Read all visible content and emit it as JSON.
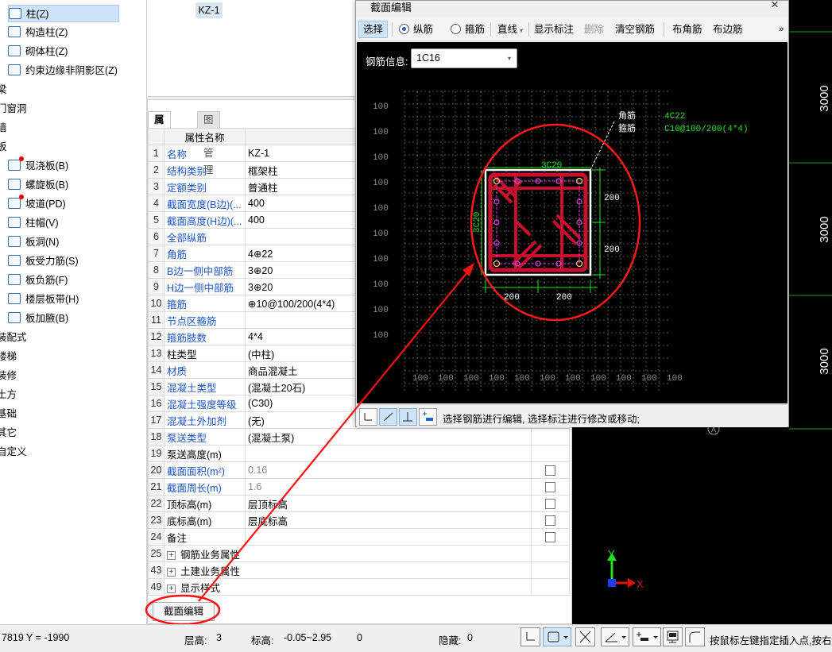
{
  "tree": {
    "items": [
      {
        "label": "柱(Z)",
        "icon": "column-icon",
        "selected": true
      },
      {
        "label": "构造柱(Z)",
        "icon": "construction-column-icon"
      },
      {
        "label": "砌体柱(Z)",
        "icon": "masonry-column-icon"
      },
      {
        "label": "约束边缘非阴影区(Z)",
        "icon": "constraint-edge-icon"
      },
      {
        "label": "梁",
        "icon": ""
      },
      {
        "label": "门窗洞",
        "icon": ""
      },
      {
        "label": "墙",
        "icon": ""
      },
      {
        "label": "板",
        "icon": ""
      },
      {
        "label": "现浇板(B)",
        "icon": "cast-slab-icon",
        "dot": true
      },
      {
        "label": "螺旋板(B)",
        "icon": "spiral-slab-icon"
      },
      {
        "label": "坡道(PD)",
        "icon": "ramp-icon",
        "dot": true
      },
      {
        "label": "柱帽(V)",
        "icon": "column-cap-icon"
      },
      {
        "label": "板洞(N)",
        "icon": "slab-hole-icon"
      },
      {
        "label": "板受力筋(S)",
        "icon": "slab-stress-rebar-icon"
      },
      {
        "label": "板负筋(F)",
        "icon": "slab-negative-rebar-icon"
      },
      {
        "label": "楼层板带(H)",
        "icon": "floor-strip-icon"
      },
      {
        "label": "板加腋(B)",
        "icon": "slab-haunch-icon"
      },
      {
        "label": "装配式",
        "icon": ""
      },
      {
        "label": "楼梯",
        "icon": ""
      },
      {
        "label": "装修",
        "icon": ""
      },
      {
        "label": "土方",
        "icon": ""
      },
      {
        "label": "基础",
        "icon": ""
      },
      {
        "label": "其它",
        "icon": ""
      },
      {
        "label": "自定义",
        "icon": ""
      }
    ]
  },
  "preview": {
    "chip": "KZ-1"
  },
  "props": {
    "tabs": [
      "属性列表",
      "图层管理"
    ],
    "header": "属性名称",
    "rows": [
      {
        "num": "1",
        "name": "名称",
        "value": "KZ-1",
        "blue": true
      },
      {
        "num": "2",
        "name": "结构类别",
        "value": "框架柱",
        "blue": true
      },
      {
        "num": "3",
        "name": "定额类别",
        "value": "普通柱",
        "blue": true
      },
      {
        "num": "4",
        "name": "截面宽度(B边)(...",
        "value": "400",
        "blue": true
      },
      {
        "num": "5",
        "name": "截面高度(H边)(...",
        "value": "400",
        "blue": true
      },
      {
        "num": "6",
        "name": "全部纵筋",
        "value": "",
        "blue": true
      },
      {
        "num": "7",
        "name": "角筋",
        "value": "4⊕22",
        "blue": true
      },
      {
        "num": "8",
        "name": "B边一侧中部筋",
        "value": "3⊕20",
        "blue": true
      },
      {
        "num": "9",
        "name": "H边一侧中部筋",
        "value": "3⊕20",
        "blue": true
      },
      {
        "num": "10",
        "name": "箍筋",
        "value": "⊕10@100/200(4*4)",
        "blue": true
      },
      {
        "num": "11",
        "name": "节点区箍筋",
        "value": "",
        "blue": true
      },
      {
        "num": "12",
        "name": "箍筋肢数",
        "value": "4*4",
        "blue": true
      },
      {
        "num": "13",
        "name": "柱类型",
        "value": "(中柱)",
        "blue": false
      },
      {
        "num": "14",
        "name": "材质",
        "value": "商品混凝土",
        "blue": true
      },
      {
        "num": "15",
        "name": "混凝土类型",
        "value": "(混凝土20石)",
        "blue": true
      },
      {
        "num": "16",
        "name": "混凝土强度等级",
        "value": "(C30)",
        "blue": true
      },
      {
        "num": "17",
        "name": "混凝土外加剂",
        "value": "(无)",
        "blue": true
      },
      {
        "num": "18",
        "name": "泵送类型",
        "value": "(混凝土泵)",
        "blue": true
      },
      {
        "num": "19",
        "name": "泵送高度(m)",
        "value": "",
        "blue": false
      },
      {
        "num": "20",
        "name": "截面面积(m²)",
        "value": "0.16",
        "blue": true,
        "grey": true,
        "check": true
      },
      {
        "num": "21",
        "name": "截面周长(m)",
        "value": "1.6",
        "blue": true,
        "grey": true,
        "check": true
      },
      {
        "num": "22",
        "name": "顶标高(m)",
        "value": "层顶标高",
        "blue": false,
        "check": true
      },
      {
        "num": "23",
        "name": "底标高(m)",
        "value": "层底标高",
        "blue": false,
        "check": true
      },
      {
        "num": "24",
        "name": "备注",
        "value": "",
        "blue": false,
        "check": true
      },
      {
        "num": "25",
        "name": "钢筋业务属性",
        "value": "",
        "blue": false,
        "expand": true
      },
      {
        "num": "43",
        "name": "土建业务属性",
        "value": "",
        "blue": false,
        "expand": true
      },
      {
        "num": "49",
        "name": "显示样式",
        "value": "",
        "blue": false,
        "expand": true
      }
    ],
    "section_button": "截面编辑"
  },
  "dialog": {
    "title": "截面编辑",
    "close": "×",
    "toolbar": {
      "select": "选择",
      "longitudinal": "纵筋",
      "stirrup": "箍筋",
      "line": "直线",
      "show_label": "显示标注",
      "delete": "删除",
      "clear": "清空钢筋",
      "corner": "布角筋",
      "edge": "布边筋",
      "more": "»"
    },
    "rebar_info_label": "钢筋信息:",
    "rebar_info_value": "1C16",
    "grid_label": "100",
    "annot": {
      "corner_label": "角筋",
      "corner_value": "4C22",
      "stirrup_label": "箍筋",
      "stirrup_value": "C10@100/200(4*4)",
      "top": "3C20",
      "left": "3C20",
      "dim": "200"
    },
    "hint": "选择钢筋进行编辑, 选择标注进行修改或移动;"
  },
  "canvas": {
    "axis_label": "3000",
    "x": "X",
    "y": "Y",
    "circle_mark": "A"
  },
  "status": {
    "coord": "7819 Y = -1990",
    "floor_label": "层高:",
    "floor_value": "3",
    "elev_label": "标高:",
    "elev_value": "-0.05~2.95",
    "zero": "0",
    "hidden_label": "隐藏:",
    "hidden_value": "0",
    "hint": "按鼠标左键指定插入点,按右键"
  },
  "colors": {
    "accent": "#1c55c8",
    "rebar": "#c8102e",
    "annotation_red": "#ff1a1a",
    "green": "#22e022",
    "grid": "#7a7a7a"
  }
}
